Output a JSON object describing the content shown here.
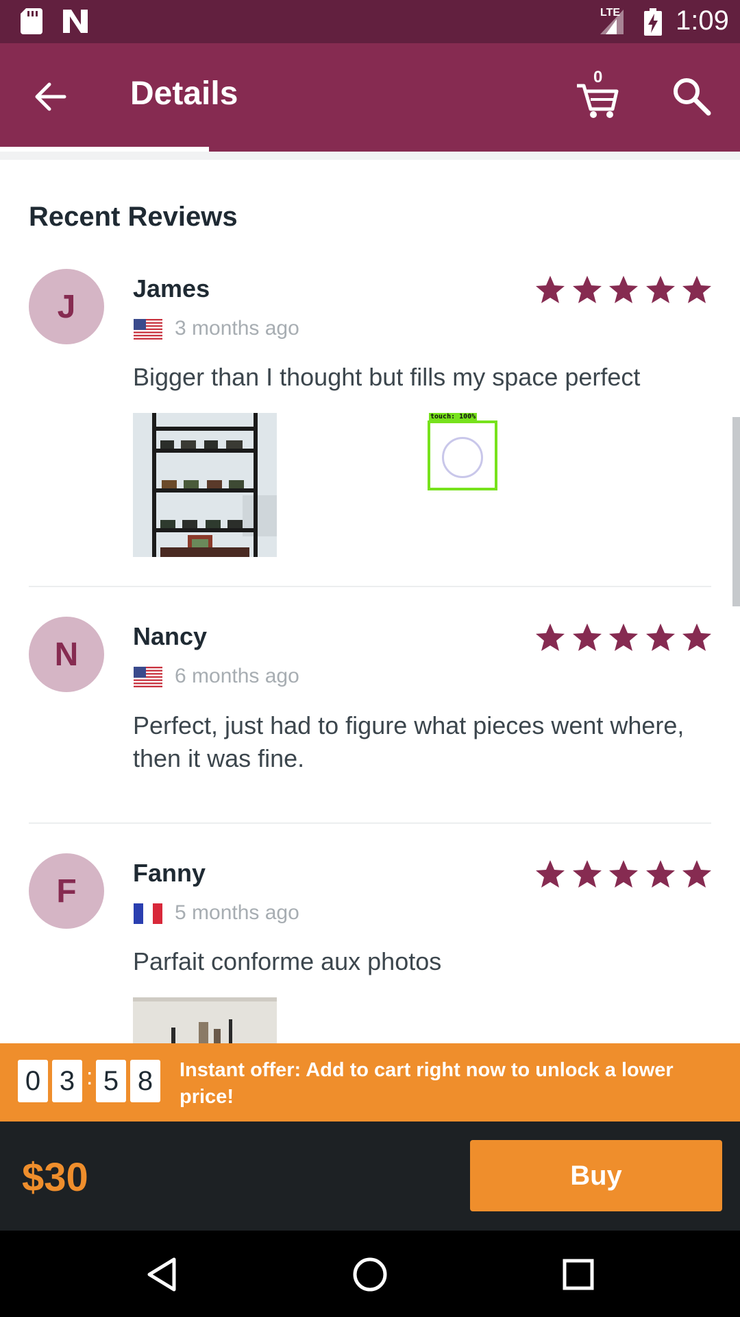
{
  "status_bar": {
    "network": "LTE",
    "time": "1:09"
  },
  "app_bar": {
    "title": "Details",
    "cart_count": "0"
  },
  "section_title": "Recent Reviews",
  "reviews": [
    {
      "initial": "J",
      "name": "James",
      "rating": 5,
      "date": "3 months ago",
      "country_flag": "us-flag",
      "text": "Bigger than I thought but fills my space perfect"
    },
    {
      "initial": "N",
      "name": "Nancy",
      "rating": 5,
      "date": "6 months ago",
      "country_flag": "us-flag",
      "text": "Perfect, just had to figure what pieces went where, then it was fine."
    },
    {
      "initial": "F",
      "name": "Fanny",
      "rating": 5,
      "date": "5 months ago",
      "country_flag": "fr-flag",
      "text": "Parfait conforme aux photos"
    }
  ],
  "touch_overlay": {
    "label": "touch: 100%"
  },
  "offer": {
    "countdown": [
      "0",
      "3",
      "5",
      "8"
    ],
    "separator": ":",
    "text": "Instant offer: Add to cart right now to unlock a lower price!"
  },
  "purchase": {
    "price": "$30",
    "buy_label": "Buy"
  },
  "colors": {
    "status_bar": "#62203f",
    "app_bar": "#862b51",
    "accent_orange": "#ef8e2c",
    "star": "#862b51",
    "avatar_bg": "#d5b5c5"
  },
  "nav_bar": {
    "icons": [
      "back-icon",
      "home-icon",
      "recents-icon"
    ]
  }
}
